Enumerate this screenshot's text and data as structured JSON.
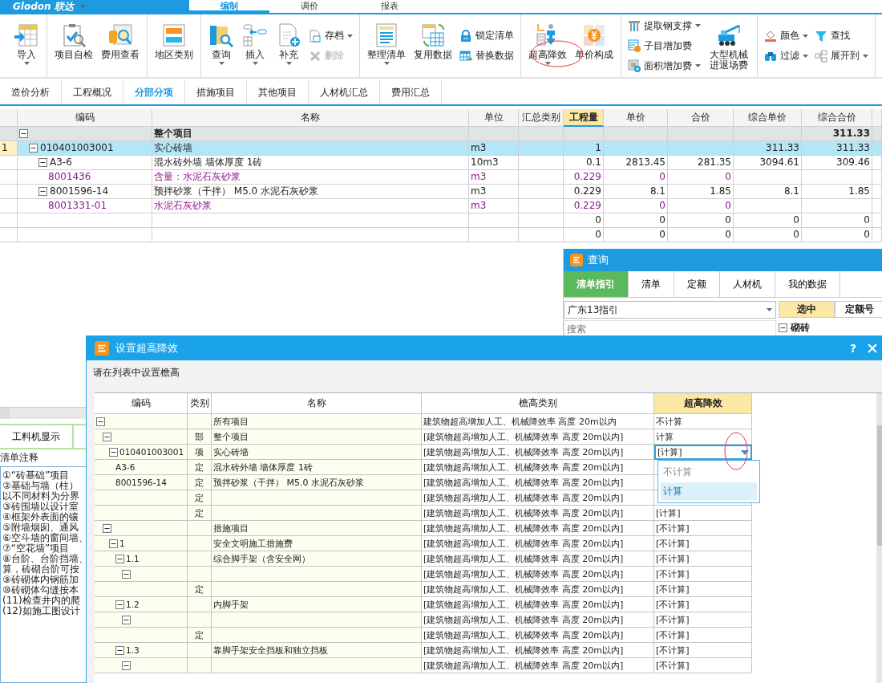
{
  "app_bar": {
    "logo": "Glodon 联达",
    "tabs": [
      {
        "label": "编制",
        "selected": true
      },
      {
        "label": "调价",
        "selected": false
      },
      {
        "label": "报表",
        "selected": false
      }
    ]
  },
  "toolbar": {
    "groups": [
      {
        "columns": [
          [
            {
              "kind": "big",
              "label": "导入",
              "caret": true,
              "disabled": false
            }
          ]
        ]
      },
      {
        "columns": [
          [
            {
              "kind": "big",
              "label": "项目自检",
              "caret": false,
              "disabled": false
            }
          ],
          [
            {
              "kind": "big",
              "label": "费用查看",
              "caret": false,
              "disabled": false
            }
          ]
        ]
      },
      {
        "columns": [
          [
            {
              "kind": "big",
              "label": "地区类别",
              "caret": false,
              "disabled": false
            }
          ]
        ]
      },
      {
        "columns": [
          [
            {
              "kind": "big",
              "label": "查询",
              "caret": true,
              "disabled": false
            }
          ],
          [
            {
              "kind": "big",
              "label": "插入",
              "caret": true,
              "disabled": false
            }
          ],
          [
            {
              "kind": "big",
              "label": "补充",
              "caret": true,
              "disabled": false
            }
          ],
          [
            {
              "kind": "small",
              "label": "存档",
              "caret": true,
              "disabled": false
            },
            {
              "kind": "small",
              "label": "删除",
              "caret": false,
              "disabled": true
            }
          ]
        ]
      },
      {
        "columns": [
          [
            {
              "kind": "big",
              "label": "整理清单",
              "caret": true,
              "disabled": false
            }
          ],
          [
            {
              "kind": "big",
              "label": "复用数据",
              "caret": false,
              "disabled": false
            }
          ],
          [
            {
              "kind": "small",
              "label": "锁定清单",
              "caret": false,
              "disabled": false
            },
            {
              "kind": "small",
              "label": "替换数据",
              "caret": false,
              "disabled": false
            }
          ]
        ]
      },
      {
        "columns": [
          [
            {
              "kind": "big",
              "label": "超高降效",
              "caret": true,
              "disabled": false
            }
          ],
          [
            {
              "kind": "big",
              "label": "单价构成",
              "caret": false,
              "disabled": false
            }
          ]
        ]
      },
      {
        "columns": [
          [
            {
              "kind": "small",
              "label": "提取钢支撑",
              "caret": true,
              "disabled": false
            },
            {
              "kind": "small",
              "label": "子目增加费",
              "caret": false,
              "disabled": false
            },
            {
              "kind": "small",
              "label": "面积增加费",
              "caret": true,
              "disabled": false
            }
          ],
          [
            {
              "kind": "big",
              "label": "大型机械进退场费",
              "caret": false,
              "disabled": false
            }
          ]
        ]
      },
      {
        "columns": [
          [
            {
              "kind": "small",
              "label": "颜色",
              "caret": true,
              "disabled": false
            },
            {
              "kind": "small",
              "label": "过滤",
              "caret": true,
              "disabled": false
            }
          ],
          [
            {
              "kind": "small",
              "label": "查找",
              "caret": false,
              "disabled": false
            },
            {
              "kind": "small",
              "label": "展开到",
              "caret": true,
              "disabled": false
            }
          ]
        ]
      }
    ]
  },
  "module_tabs": [
    {
      "label": "造价分析",
      "selected": false
    },
    {
      "label": "工程概况",
      "selected": false
    },
    {
      "label": "分部分项",
      "selected": true
    },
    {
      "label": "措施项目",
      "selected": false
    },
    {
      "label": "其他项目",
      "selected": false
    },
    {
      "label": "人材机汇总",
      "selected": false
    },
    {
      "label": "费用汇总",
      "selected": false
    }
  ],
  "main_table": {
    "columns": [
      {
        "label": "编码",
        "highlighted": false
      },
      {
        "label": "名称",
        "highlighted": false
      },
      {
        "label": "单位",
        "highlighted": false
      },
      {
        "label": "汇总类别",
        "highlighted": false
      },
      {
        "label": "工程量",
        "highlighted": true
      },
      {
        "label": "单价",
        "highlighted": false
      },
      {
        "label": "合价",
        "highlighted": false
      },
      {
        "label": "综合单价",
        "highlighted": false
      },
      {
        "label": "综合合价",
        "highlighted": false
      }
    ],
    "rows": [
      {
        "kind": "summary",
        "selected": false,
        "expanded": true,
        "name": "整个项目",
        "sum_total": "311.33",
        "children": [
          {
            "selected": true,
            "number": "1",
            "expanded": true,
            "code": "010401003001",
            "name": "实心砖墙",
            "unit": "m3",
            "qty": "1",
            "unit_total": "311.33",
            "sum_total": "311.33",
            "children": [
              {
                "selected": false,
                "expanded": true,
                "code": "A3-6",
                "name": "混水砖外墙 墙体厚度 1砖",
                "unit": "10m3",
                "qty": "0.1",
                "price": "2813.45",
                "total": "281.35",
                "unit_total": "3094.61",
                "sum_total": "309.46",
                "children": [
                  {
                    "kind": "material",
                    "selected": false,
                    "code": "8001436",
                    "name": "含量：水泥石灰砂浆",
                    "unit": "m3",
                    "qty": "0.229",
                    "price": "0",
                    "total": "0"
                  }
                ]
              },
              {
                "selected": false,
                "expanded": true,
                "code": "8001596-14",
                "name": "预拌砂浆（干拌） M5.0 水泥石灰砂浆",
                "unit": "m3",
                "qty": "0.229",
                "price": "8.1",
                "total": "1.85",
                "unit_total": "8.1",
                "sum_total": "1.85",
                "children": [
                  {
                    "kind": "material",
                    "selected": false,
                    "code": "8001331-01",
                    "name": "水泥石灰砂浆",
                    "unit": "m3",
                    "qty": "0.229",
                    "price": "0",
                    "total": "0"
                  }
                ]
              },
              {
                "selected": false,
                "qty": "0",
                "price": "0",
                "total": "0",
                "unit_total": "0",
                "sum_total": "0"
              },
              {
                "selected": false,
                "qty": "0",
                "price": "0",
                "total": "0",
                "unit_total": "0",
                "sum_total": "0"
              }
            ]
          }
        ]
      }
    ]
  },
  "query_panel": {
    "title": "查询",
    "tabs": [
      {
        "label": "清单指引",
        "selected": true
      },
      {
        "label": "清单",
        "selected": false
      },
      {
        "label": "定额",
        "selected": false
      },
      {
        "label": "人材机",
        "selected": false
      },
      {
        "label": "我的数据",
        "selected": false
      }
    ],
    "guide": "广东13指引",
    "search_placeholder": "搜索",
    "grid_columns": [
      {
        "label": "选中",
        "highlighted": true
      },
      {
        "label": "定额号",
        "highlighted": false
      }
    ],
    "grid_rows": [
      {
        "name": "砌砖",
        "expanded": true
      }
    ]
  },
  "left_panel": {
    "tab": "工料机显示",
    "notes_title": "清单注释",
    "notes": [
      "①“砖基础”项目",
      "②基础与墙（柱）",
      "以不同材料为分界",
      "③砖围墙以设计室",
      "④框架外表面的镶",
      "⑤附墙烟囱、通风",
      "⑥空斗墙的窗间墙、",
      "⑦“空花墙”项目",
      "⑧台阶、台阶挡墙、",
      "算，砖砌台阶可按",
      "⑨砖砌体内钢筋加",
      "⑩砖砌体勾缝按本",
      "(11)检查井内的爬",
      "(12)如施工图设计"
    ]
  },
  "dialog": {
    "title": "设置超高降效",
    "help": "?",
    "instruction": "请在列表中设置檐高",
    "columns": [
      {
        "label": "编码",
        "highlighted": false
      },
      {
        "label": "类别",
        "highlighted": false
      },
      {
        "label": "名称",
        "highlighted": false
      },
      {
        "label": "檐高类别",
        "highlighted": false
      },
      {
        "label": "超高降效",
        "highlighted": true
      }
    ],
    "rows": [
      {
        "expanded": true,
        "name": "所有项目",
        "eave_category": "建筑物超高增加人工、机械降效率 高度 20m以内",
        "value": "不计算",
        "editing": false,
        "children": [
          {
            "expanded": true,
            "type": "部",
            "name": "整个项目",
            "eave_category": "[建筑物超高增加人工、机械降效率 高度 20m以内]",
            "value": "计算",
            "editing": false,
            "children": [
              {
                "expanded": true,
                "code": "010401003001",
                "type": "项",
                "name": "实心砖墙",
                "eave_category": "[建筑物超高增加人工、机械降效率 高度 20m以内]",
                "value": "[计算]",
                "editing": true,
                "children": [
                  {
                    "code": "A3-6",
                    "type": "定",
                    "name": "混水砖外墙 墙体厚度 1砖",
                    "eave_category": "[建筑物超高增加人工、机械降效率 高度 20m以内]",
                    "editing": false
                  },
                  {
                    "code": "8001596-14",
                    "type": "定",
                    "name": "预拌砂浆（干拌） M5.0 水泥石灰砂浆",
                    "eave_category": "[建筑物超高增加人工、机械降效率 高度 20m以内]",
                    "editing": false
                  },
                  {
                    "type": "定",
                    "eave_category": "[建筑物超高增加人工、机械降效率 高度 20m以内]",
                    "editing": false
                  },
                  {
                    "type": "定",
                    "eave_category": "[建筑物超高增加人工、机械降效率 高度 20m以内]",
                    "value": "[计算]",
                    "editing": false
                  }
                ]
              }
            ]
          },
          {
            "expanded": true,
            "name": "措施项目",
            "eave_category": "[建筑物超高增加人工、机械降效率 高度 20m以内]",
            "value": "[不计算]",
            "editing": false,
            "children": [
              {
                "expanded": true,
                "code": "1",
                "name": "安全文明施工措施费",
                "eave_category": "[建筑物超高增加人工、机械降效率 高度 20m以内]",
                "value": "[不计算]",
                "editing": false,
                "children": [
                  {
                    "expanded": true,
                    "code": "1.1",
                    "name": "综合脚手架（含安全网）",
                    "eave_category": "[建筑物超高增加人工、机械降效率 高度 20m以内]",
                    "value": "[不计算]",
                    "editing": false,
                    "children": [
                      {
                        "expanded": true,
                        "eave_category": "[建筑物超高增加人工、机械降效率 高度 20m以内]",
                        "value": "[不计算]",
                        "editing": false,
                        "children": [
                          {
                            "type": "定",
                            "eave_category": "[建筑物超高增加人工、机械降效率 高度 20m以内]",
                            "value": "[不计算]",
                            "editing": false
                          }
                        ]
                      }
                    ]
                  },
                  {
                    "expanded": true,
                    "code": "1.2",
                    "name": "内脚手架",
                    "eave_category": "[建筑物超高增加人工、机械降效率 高度 20m以内]",
                    "value": "[不计算]",
                    "editing": false,
                    "children": [
                      {
                        "expanded": true,
                        "eave_category": "[建筑物超高增加人工、机械降效率 高度 20m以内]",
                        "value": "[不计算]",
                        "editing": false,
                        "children": [
                          {
                            "type": "定",
                            "eave_category": "[建筑物超高增加人工、机械降效率 高度 20m以内]",
                            "value": "[不计算]",
                            "editing": false
                          }
                        ]
                      }
                    ]
                  },
                  {
                    "expanded": true,
                    "code": "1.3",
                    "name": "靠脚手架安全挡板和独立挡板",
                    "eave_category": "[建筑物超高增加人工、机械降效率 高度 20m以内]",
                    "value": "[不计算]",
                    "editing": false,
                    "children": [
                      {
                        "expanded": true,
                        "eave_category": "[建筑物超高增加人工、机械降效率 高度 20m以内]",
                        "value": "[不计算]",
                        "editing": false
                      }
                    ]
                  }
                ]
              }
            ]
          }
        ]
      }
    ],
    "dropdown": [
      {
        "label": "不计算",
        "selected": false
      },
      {
        "label": "计算",
        "selected": true
      }
    ]
  }
}
